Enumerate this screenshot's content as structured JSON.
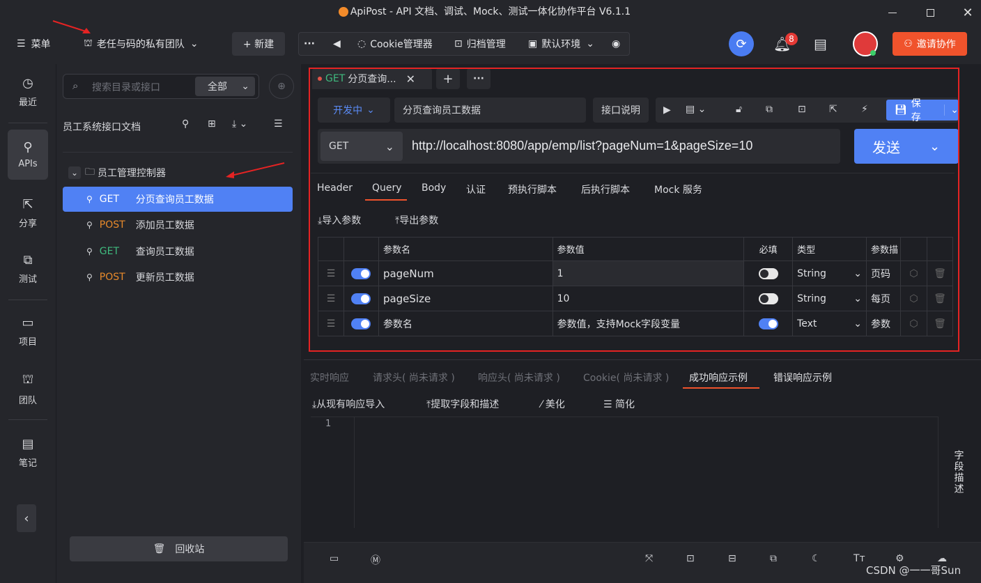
{
  "window": {
    "title": "ApiPost - API 文档、调试、Mock、测试一体化协作平台 V6.1.1"
  },
  "topbar": {
    "menu_label": "菜单",
    "team_name": "老任与码的私有团队",
    "new_label": "+ 新建",
    "more_label": "···",
    "cookie_label": "Cookie管理器",
    "archive_label": "归档管理",
    "env_label": "默认环境",
    "notification_count": "8",
    "invite_label": "邀请协作",
    "accent": "#f0532c"
  },
  "leftnav": {
    "items": [
      {
        "label": "最近",
        "icon": "clock-icon"
      },
      {
        "label": "APIs",
        "icon": "link-icon"
      },
      {
        "label": "分享",
        "icon": "share-icon"
      },
      {
        "label": "测试",
        "icon": "test-icon"
      },
      {
        "label": "项目",
        "icon": "project-icon"
      },
      {
        "label": "团队",
        "icon": "team-icon"
      },
      {
        "label": "笔记",
        "icon": "note-icon"
      }
    ],
    "collapse_icon": "chevron-left-icon"
  },
  "sidebar": {
    "search_placeholder": "搜索目录或接口",
    "filter_value": "全部",
    "doc_title": "员工系统接口文档",
    "folder_name": "员工管理控制器",
    "items": [
      {
        "method": "GET",
        "name": "分页查询员工数据"
      },
      {
        "method": "POST",
        "name": "添加员工数据"
      },
      {
        "method": "GET",
        "name": "查询员工数据"
      },
      {
        "method": "POST",
        "name": "更新员工数据"
      }
    ],
    "recycle_label": "回收站"
  },
  "request": {
    "tab_method": "GET",
    "tab_title": "分页查询...",
    "status": "开发中",
    "name": "分页查询员工数据",
    "doc_button": "接口说明",
    "save_label": "保存",
    "method": "GET",
    "url": "http://localhost:8080/app/emp/list?pageNum=1&pageSize=10",
    "send_label": "发送",
    "tabs": [
      "Header",
      "Query",
      "Body",
      "认证",
      "预执行脚本",
      "后执行脚本",
      "Mock 服务"
    ],
    "active_tab": "Query",
    "import_label": "导入参数",
    "export_label": "导出参数",
    "columns": [
      "参数名",
      "参数值",
      "必填",
      "类型",
      "参数描"
    ],
    "params": [
      {
        "name": "pageNum",
        "value": "1",
        "type": "String",
        "desc": "页码"
      },
      {
        "name": "pageSize",
        "value": "10",
        "type": "String",
        "desc": "每页"
      }
    ],
    "new_row": {
      "name_placeholder": "参数名",
      "value_placeholder": "参数值，支持Mock字段变量",
      "type": "Text",
      "desc_placeholder": "参数"
    }
  },
  "response": {
    "tabs": [
      "实时响应",
      "请求头( 尚未请求 )",
      "响应头( 尚未请求 )",
      "Cookie( 尚未请求 )",
      "成功响应示例",
      "错误响应示例"
    ],
    "active_tab": "成功响应示例",
    "actions": [
      "从现有响应导入",
      "提取字段和描述",
      "美化",
      "简化"
    ],
    "line_number": "1",
    "side_label": "字段描述"
  },
  "watermark": "CSDN @一一哥Sun"
}
